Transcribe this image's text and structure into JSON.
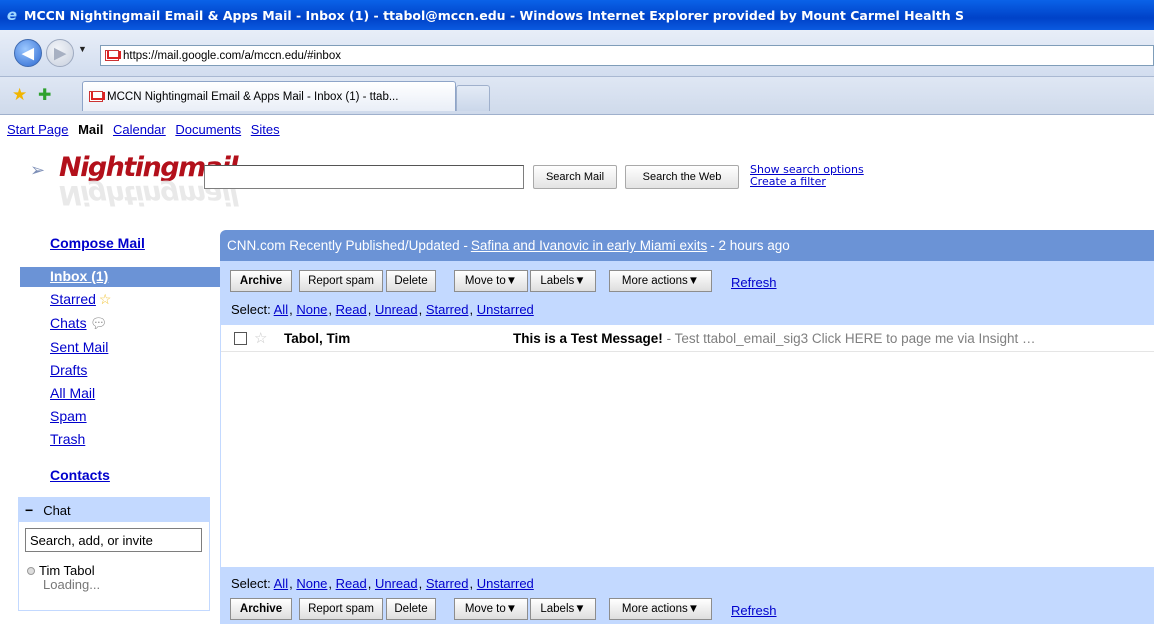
{
  "window": {
    "title": "MCCN Nightingmail Email & Apps Mail - Inbox (1) - ttabol@mccn.edu - Windows Internet Explorer provided by Mount Carmel Health S"
  },
  "browser": {
    "url": "https://mail.google.com/a/mccn.edu/#inbox",
    "tab_title": "MCCN Nightingmail Email & Apps Mail - Inbox (1) - ttab..."
  },
  "topnav": {
    "start_page": "Start Page",
    "mail": "Mail",
    "calendar": "Calendar",
    "documents": "Documents",
    "sites": "Sites"
  },
  "logo": {
    "text": "Nightingmail"
  },
  "search": {
    "value": "",
    "search_mail": "Search Mail",
    "search_web": "Search the Web",
    "show_options": "Show search options",
    "create_filter": "Create a filter"
  },
  "sidebar": {
    "compose": "Compose Mail",
    "inbox": "Inbox (1)",
    "starred": "Starred",
    "chats": "Chats",
    "sent": "Sent Mail",
    "drafts": "Drafts",
    "all_mail": "All Mail",
    "spam": "Spam",
    "trash": "Trash",
    "contacts": "Contacts"
  },
  "chat": {
    "collapse": "−",
    "title": "Chat",
    "search_placeholder": "Search, add, or invite",
    "user": "Tim Tabol",
    "status": "Loading..."
  },
  "webclip": {
    "source": "CNN.com Recently Published/Updated - ",
    "link": "Safina and Ivanovic in early Miami exits",
    "age": " - 2 hours ago"
  },
  "toolbar": {
    "archive": "Archive",
    "report_spam": "Report spam",
    "delete": "Delete",
    "move_to": "Move to▼",
    "labels": "Labels▼",
    "more_actions": "More actions▼",
    "refresh": "Refresh"
  },
  "select": {
    "label": "Select: ",
    "all": "All",
    "none": "None",
    "read": "Read",
    "unread": "Unread",
    "starred": "Starred",
    "unstarred": "Unstarred"
  },
  "messages": [
    {
      "sender": "Tabol, Tim",
      "subject": "This is a Test Message!",
      "snippet": " - Test ttabol_email_sig3 Click HERE to page me via Insight …"
    }
  ],
  "colors": {
    "accent": "#6b93d6",
    "toolbar_bg": "#c3d9ff",
    "link": "#0000cc",
    "logo": "#b3101b"
  }
}
